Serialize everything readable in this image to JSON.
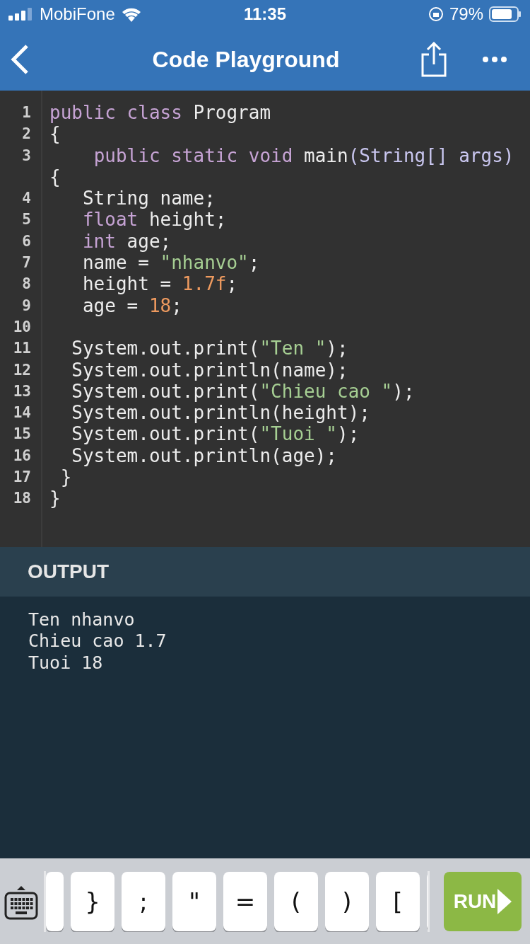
{
  "status_bar": {
    "carrier": "MobiFone",
    "time": "11:35",
    "battery": "79%"
  },
  "nav": {
    "title": "Code Playground"
  },
  "editor": {
    "lines": [
      {
        "number": "1",
        "tokens": [
          {
            "text": "public class ",
            "kind": "keyword"
          },
          {
            "text": "Program",
            "kind": "plain"
          }
        ]
      },
      {
        "number": "2",
        "tokens": [
          {
            "text": "{",
            "kind": "plain"
          }
        ]
      },
      {
        "number": "3",
        "tokens": [
          {
            "text": "    public static void ",
            "kind": "keyword"
          },
          {
            "text": "main",
            "kind": "plain"
          },
          {
            "text": "(String[] args) ",
            "kind": "type"
          },
          {
            "text": "{",
            "kind": "plain"
          }
        ]
      },
      {
        "number": "4",
        "tokens": [
          {
            "text": "   String name;",
            "kind": "plain"
          }
        ]
      },
      {
        "number": "5",
        "tokens": [
          {
            "text": "   float ",
            "kind": "keyword"
          },
          {
            "text": "height;",
            "kind": "plain"
          }
        ]
      },
      {
        "number": "6",
        "tokens": [
          {
            "text": "   int ",
            "kind": "keyword"
          },
          {
            "text": "age;",
            "kind": "plain"
          }
        ]
      },
      {
        "number": "7",
        "tokens": [
          {
            "text": "   name = ",
            "kind": "plain"
          },
          {
            "text": "\"nhanvo\"",
            "kind": "string"
          },
          {
            "text": ";",
            "kind": "plain"
          }
        ]
      },
      {
        "number": "8",
        "tokens": [
          {
            "text": "   height = ",
            "kind": "plain"
          },
          {
            "text": "1.7f",
            "kind": "number"
          },
          {
            "text": ";",
            "kind": "plain"
          }
        ]
      },
      {
        "number": "9",
        "tokens": [
          {
            "text": "   age = ",
            "kind": "plain"
          },
          {
            "text": "18",
            "kind": "number"
          },
          {
            "text": ";",
            "kind": "plain"
          }
        ]
      },
      {
        "number": "10"
      },
      {
        "number": "11",
        "tokens": [
          {
            "text": "  System.out.print(",
            "kind": "plain"
          },
          {
            "text": "\"Ten \"",
            "kind": "string"
          },
          {
            "text": ");",
            "kind": "plain"
          }
        ]
      },
      {
        "number": "12",
        "tokens": [
          {
            "text": "  System.out.println(name);",
            "kind": "plain"
          }
        ]
      },
      {
        "number": "13",
        "tokens": [
          {
            "text": "  System.out.print(",
            "kind": "plain"
          },
          {
            "text": "\"Chieu cao \"",
            "kind": "string"
          },
          {
            "text": ");",
            "kind": "plain"
          }
        ]
      },
      {
        "number": "14",
        "tokens": [
          {
            "text": "  System.out.println(height);",
            "kind": "plain"
          }
        ]
      },
      {
        "number": "15",
        "tokens": [
          {
            "text": "  System.out.print(",
            "kind": "plain"
          },
          {
            "text": "\"Tuoi \"",
            "kind": "string"
          },
          {
            "text": ");",
            "kind": "plain"
          }
        ]
      },
      {
        "number": "16",
        "tokens": [
          {
            "text": "  System.out.println(age);",
            "kind": "plain"
          }
        ]
      },
      {
        "number": "17",
        "tokens": [
          {
            "text": " }",
            "kind": "plain"
          }
        ]
      },
      {
        "number": "18",
        "tokens": [
          {
            "text": "}",
            "kind": "plain"
          }
        ]
      }
    ]
  },
  "output": {
    "title": "OUTPUT",
    "lines": [
      "Ten nhanvo",
      "Chieu cao 1.7",
      "Tuoi 18"
    ]
  },
  "keys": [
    "}",
    ";",
    "\"",
    "=",
    "(",
    ")",
    "["
  ],
  "run_button": "RUN"
}
